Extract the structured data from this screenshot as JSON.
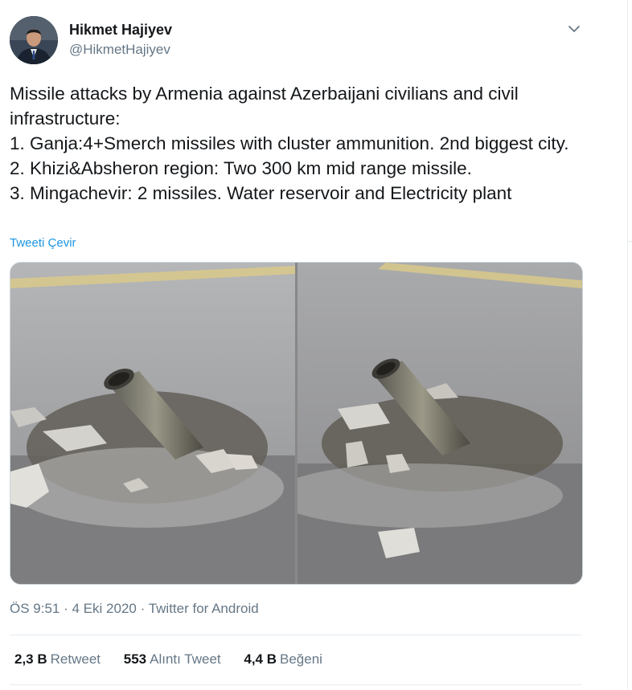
{
  "author": {
    "name": "Hikmet Hajiyev",
    "handle": "@HikmetHajiyev"
  },
  "tweet": {
    "text": "Missile attacks by Armenia against Azerbaijani civilians and civil infrastructure:\n1. Ganja:4+Smerch missiles with cluster ammunition. 2nd biggest city.\n2. Khizi&Absheron region: Two 300 km mid range missile.\n3. Mingachevir: 2 missiles. Water reservoir and Electricity plant",
    "translate_label": "Tweeti Çevir"
  },
  "meta": {
    "time": "ÖS 9:51",
    "date": "4 Eki 2020",
    "source": "Twitter for Android",
    "separator": "·"
  },
  "stats": {
    "retweets_count": "2,3 B",
    "retweets_label": "Retweet",
    "quotes_count": "553",
    "quotes_label": "Alıntı Tweet",
    "likes_count": "4,4 B",
    "likes_label": "Beğeni"
  },
  "icons": {
    "caret": "chevron-down-icon"
  },
  "colors": {
    "link": "#1b95e0",
    "secondary_text": "#657786",
    "primary_text": "#14171a"
  }
}
